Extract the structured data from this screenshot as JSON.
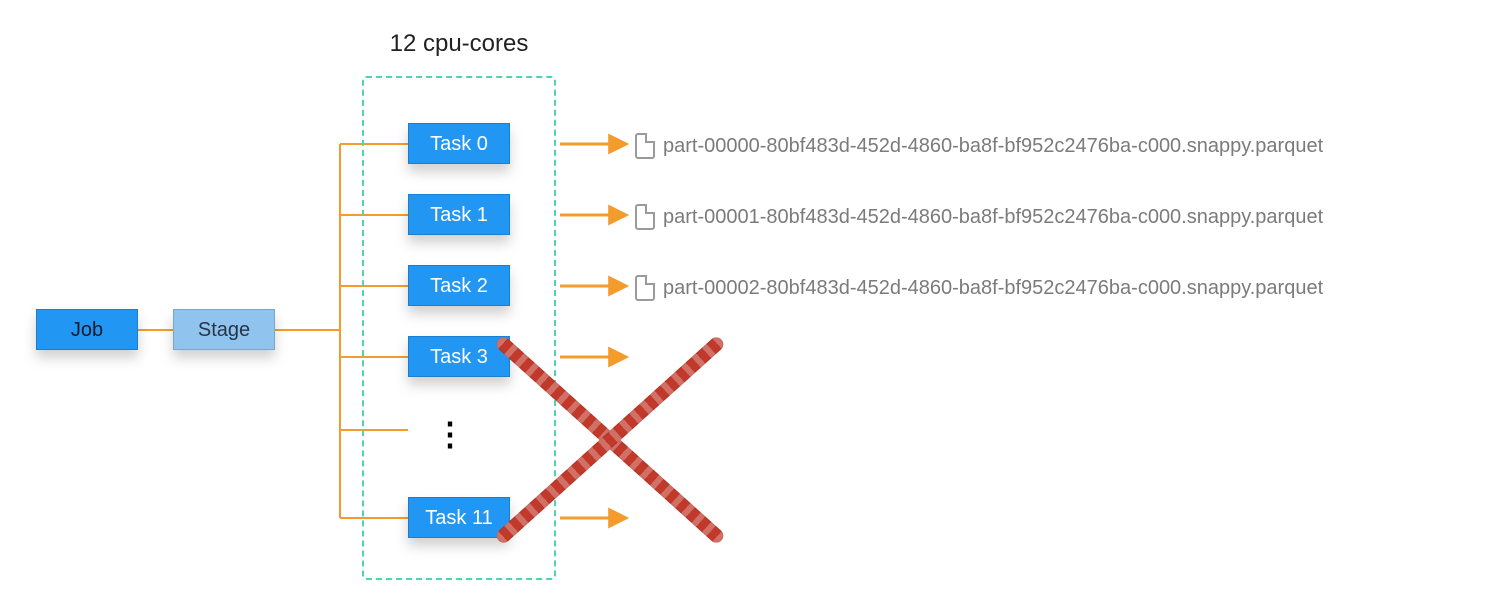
{
  "header": {
    "cpu_label": "12 cpu-cores"
  },
  "job": {
    "label": "Job"
  },
  "stage": {
    "label": "Stage"
  },
  "tasks": {
    "0": "Task 0",
    "1": "Task 1",
    "2": "Task 2",
    "3": "Task 3",
    "11": "Task 11",
    "ellipsis": "⋮"
  },
  "files": {
    "0": "part-00000-80bf483d-452d-4860-ba8f-bf952c2476ba-c000.snappy.parquet",
    "1": "part-00001-80bf483d-452d-4860-ba8f-bf952c2476ba-c000.snappy.parquet",
    "2": "part-00002-80bf483d-452d-4860-ba8f-bf952c2476ba-c000.snappy.parquet"
  },
  "colors": {
    "task_blue": "#2196f3",
    "stage_blue": "#90c4ee",
    "container_teal": "#4cd6b0",
    "connector_orange": "#f39c2c",
    "cross_red": "#c0392b",
    "filename_gray": "#7b7b7b"
  }
}
